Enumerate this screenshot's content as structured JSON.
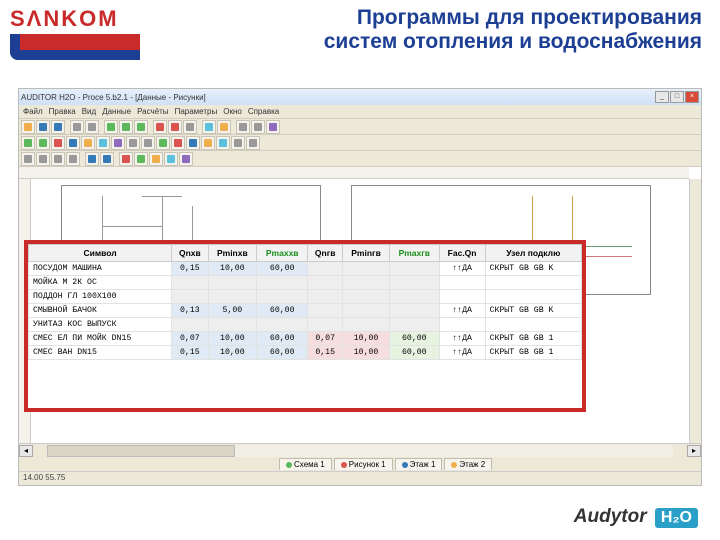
{
  "header": {
    "logo_text_a": "SΛNK",
    "logo_text_b": "OM",
    "title_l1": "Программы для проектирования",
    "title_l2": "систем отопления и водоснабжения"
  },
  "window": {
    "title": "AUDITOR H2O - Proce 5.b2.1 - [Данные - Рисунки]",
    "min": "_",
    "max": "□",
    "close": "×"
  },
  "menu": {
    "file": "Файл",
    "edit": "Правка",
    "view": "Вид",
    "data": "Данные",
    "calc": "Расчёты",
    "params": "Параметры",
    "window": "Окно",
    "help": "Справка"
  },
  "tabs": {
    "t1": "Схема 1",
    "t2": "Рисунок 1",
    "t3": "Этаж 1",
    "t4": "Этаж 2"
  },
  "status": {
    "coords": "14.00 55.75"
  },
  "table": {
    "headers": {
      "sym": "Символ",
      "qnxb": "Qnxв",
      "pminxb": "Pminxв",
      "pmaxxb": "Pmaxxв",
      "qnrb": "Qnгв",
      "pminrb": "Pminгв",
      "pmaxrb": "Pmaxгв",
      "facqn": "Fac.Qn",
      "node": "Узел подклю"
    },
    "rows": [
      {
        "sym": "ПОСУДОМ МАШИНА",
        "qnxb": "0,15",
        "pminxb": "10,00",
        "pmaxxb": "60,00",
        "qnrb": "",
        "pminrb": "",
        "pmaxrb": "",
        "facqn": "↑↑ДА",
        "node": "СКРЫТ GB GB K"
      },
      {
        "sym": "МОЙКА М 2К ОС",
        "qnxb": "",
        "pminxb": "",
        "pmaxxb": "",
        "qnrb": "",
        "pminrb": "",
        "pmaxrb": "",
        "facqn": "",
        "node": ""
      },
      {
        "sym": "ПОДДОН ГЛ 100X100",
        "qnxb": "",
        "pminxb": "",
        "pmaxxb": "",
        "qnrb": "",
        "pminrb": "",
        "pmaxrb": "",
        "facqn": "",
        "node": ""
      },
      {
        "sym": "СМЫВНОЙ БАЧОК",
        "qnxb": "0,13",
        "pminxb": "5,00",
        "pmaxxb": "60,00",
        "qnrb": "",
        "pminrb": "",
        "pmaxrb": "",
        "facqn": "↑↑ДА",
        "node": "СКРЫТ GB GB K"
      },
      {
        "sym": "УНИТАЗ КОС ВЫПУСК",
        "qnxb": "",
        "pminxb": "",
        "pmaxxb": "",
        "qnrb": "",
        "pminrb": "",
        "pmaxrb": "",
        "facqn": "",
        "node": ""
      },
      {
        "sym": "СМЕС ЕЛ ПИ МОЙК DN15",
        "qnxb": "0,07",
        "pminxb": "10,00",
        "pmaxxb": "60,00",
        "qnrb": "0,07",
        "pminrb": "10,00",
        "pmaxrb": "60,00",
        "facqn": "↑↑ДА",
        "node": "СКРЫТ GB GB 1"
      },
      {
        "sym": "СМЕС ВАН DN15",
        "qnxb": "0,15",
        "pminxb": "10,00",
        "pmaxxb": "60,00",
        "qnrb": "0,15",
        "pminrb": "10,00",
        "pmaxrb": "60,00",
        "facqn": "↑↑ДА",
        "node": "СКРЫТ GB GB 1"
      }
    ]
  },
  "footer": {
    "brand": "Audytor",
    "prod": "H₂O"
  }
}
